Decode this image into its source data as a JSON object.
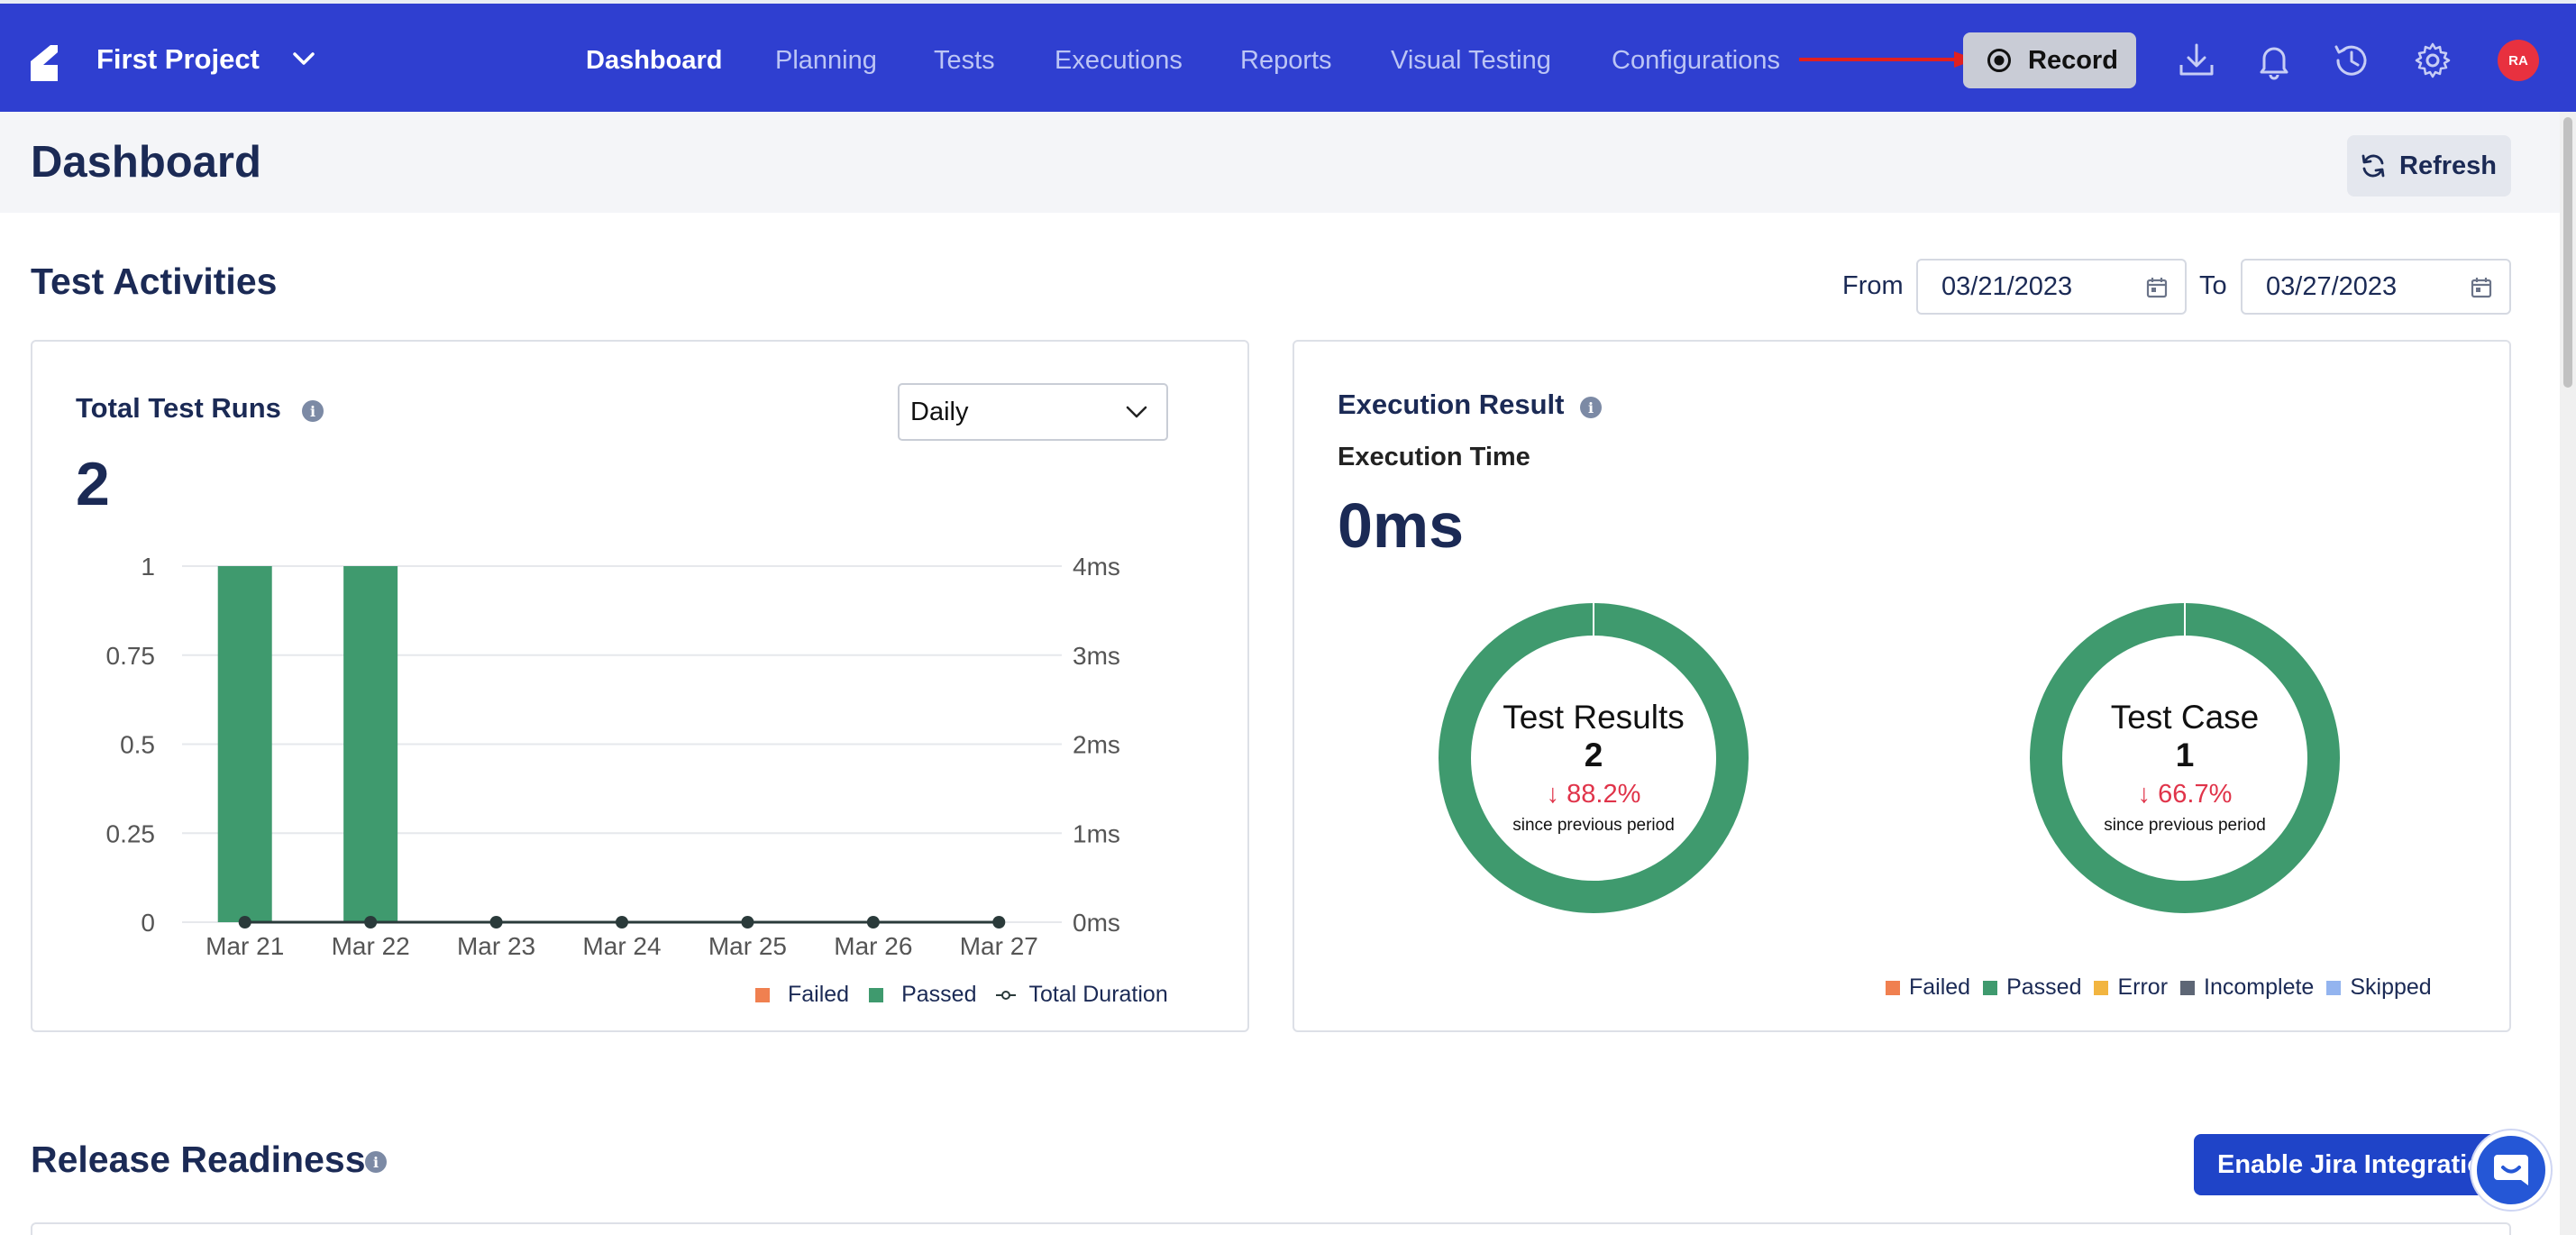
{
  "navbar": {
    "project_name": "First Project",
    "tabs": [
      {
        "label": "Dashboard",
        "active": true
      },
      {
        "label": "Planning",
        "active": false
      },
      {
        "label": "Tests",
        "active": false
      },
      {
        "label": "Executions",
        "active": false
      },
      {
        "label": "Reports",
        "active": false
      },
      {
        "label": "Visual Testing",
        "active": false
      },
      {
        "label": "Configurations",
        "active": false
      }
    ],
    "record_label": "Record",
    "icons": [
      "download-icon",
      "bell-icon",
      "history-icon",
      "gear-icon"
    ],
    "avatar_initials": "RA",
    "colors": {
      "navbar": "#2f3fd0",
      "record_bg": "#c9ccd6",
      "avatar": "#e8313f",
      "annotation_arrow": "#e02020"
    }
  },
  "header": {
    "title": "Dashboard",
    "refresh_label": "Refresh"
  },
  "test_activities": {
    "title": "Test Activities",
    "from_label": "From",
    "from_value": "03/21/2023",
    "to_label": "To",
    "to_value": "03/27/2023"
  },
  "total_runs": {
    "title": "Total Test Runs",
    "count": "2",
    "period_select": "Daily"
  },
  "execution_result": {
    "title": "Execution Result",
    "time_label": "Execution Time",
    "time_value": "0ms",
    "donuts": [
      {
        "title": "Test Results",
        "count": "2",
        "change": "88.2%",
        "change_direction": "down",
        "sub": "since previous period"
      },
      {
        "title": "Test Case",
        "count": "1",
        "change": "66.7%",
        "change_direction": "down",
        "sub": "since previous period"
      }
    ],
    "legend": [
      {
        "label": "Failed",
        "color": "#f08050"
      },
      {
        "label": "Passed",
        "color": "#3f9a6e"
      },
      {
        "label": "Error",
        "color": "#f2b540"
      },
      {
        "label": "Incomplete",
        "color": "#5d6675"
      },
      {
        "label": "Skipped",
        "color": "#93b4ef"
      }
    ]
  },
  "chart_data": [
    {
      "type": "bar",
      "title": "Total Test Runs",
      "categories": [
        "Mar 21",
        "Mar 22",
        "Mar 23",
        "Mar 24",
        "Mar 25",
        "Mar 26",
        "Mar 27"
      ],
      "series": [
        {
          "name": "Failed",
          "values": [
            0,
            0,
            0,
            0,
            0,
            0,
            0
          ],
          "color": "#f08050"
        },
        {
          "name": "Passed",
          "values": [
            1,
            1,
            0,
            0,
            0,
            0,
            0
          ],
          "color": "#3f9a6e"
        },
        {
          "name": "Total Duration",
          "type": "line",
          "axis": "right",
          "values": [
            0,
            0,
            0,
            0,
            0,
            0,
            0
          ],
          "color": "#2a3a3a"
        }
      ],
      "y_left": {
        "ticks": [
          "1",
          "0.75",
          "0.5",
          "0.25",
          "0"
        ],
        "ylim": [
          0,
          1
        ]
      },
      "y_right": {
        "ticks": [
          "4ms",
          "3ms",
          "2ms",
          "1ms",
          "0ms"
        ],
        "ylim": [
          0,
          4
        ]
      },
      "grid": true,
      "legend_position": "bottom-right"
    },
    {
      "type": "pie",
      "title": "Test Results",
      "slices": [
        {
          "name": "Passed",
          "value": 2,
          "color": "#3f9a6e"
        }
      ]
    },
    {
      "type": "pie",
      "title": "Test Case",
      "slices": [
        {
          "name": "Passed",
          "value": 1,
          "color": "#3f9a6e"
        }
      ]
    }
  ],
  "release_readiness": {
    "title": "Release Readiness",
    "jira_button": "Enable Jira Integration"
  }
}
